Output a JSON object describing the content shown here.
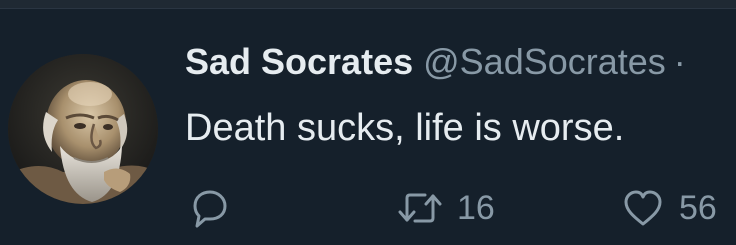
{
  "tweet": {
    "author": {
      "display_name": "Sad Socrates",
      "handle": "@SadSocrates",
      "separator": "·",
      "avatar_icon": "socrates-bust-avatar"
    },
    "text": "Death sucks, life is worse.",
    "actions": {
      "reply": {
        "icon": "reply-bubble-icon"
      },
      "retweet": {
        "icon": "retweet-arrows-icon",
        "count": "16"
      },
      "like": {
        "icon": "heart-icon",
        "count": "56"
      }
    }
  },
  "colors": {
    "background": "#15202b",
    "primary_text": "#e6ecf0",
    "secondary_text": "#8899a6"
  }
}
